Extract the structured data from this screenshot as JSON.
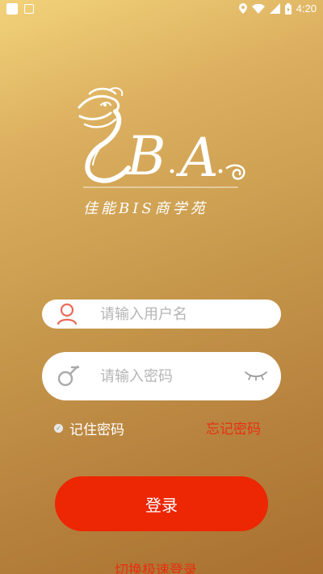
{
  "status_bar": {
    "time": "4:20"
  },
  "brand": {
    "tagline": "佳能BIS商学苑",
    "logo_letters": "CBA"
  },
  "login": {
    "username_placeholder": "请输入用户名",
    "password_placeholder": "请输入密码",
    "remember_label": "记住密码",
    "forgot_label": "忘记密码",
    "login_label": "登录",
    "switch_label": "切换极速登录"
  },
  "colors": {
    "accent": "#ed2604",
    "link": "#e83010",
    "bg_top": "#f2d27a",
    "bg_bottom": "#a9702f"
  }
}
